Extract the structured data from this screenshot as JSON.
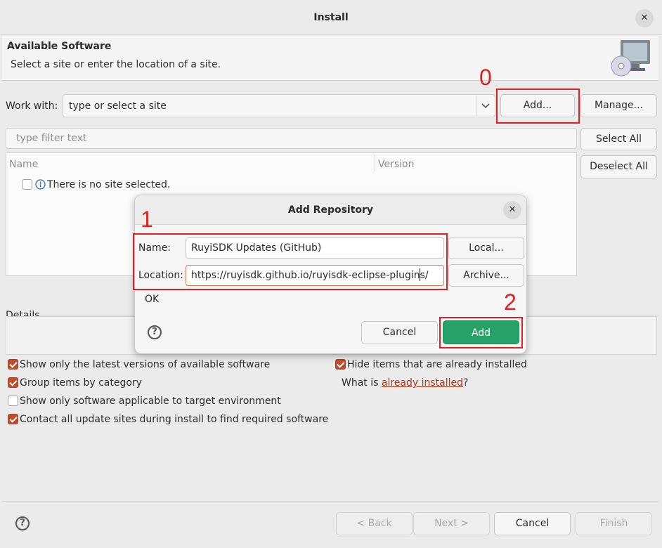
{
  "window": {
    "title": "Install",
    "close_icon": "close-icon"
  },
  "banner": {
    "title": "Available Software",
    "description": "Select a site or enter the location of a site.",
    "icon": "monitor-cd-icon"
  },
  "work_with": {
    "label": "Work with:",
    "value": "type or select a site",
    "add_label": "Add...",
    "manage_label": "Manage..."
  },
  "filter": {
    "placeholder": "type filter text",
    "select_all_label": "Select All",
    "deselect_all_label": "Deselect All"
  },
  "table": {
    "columns": [
      "Name",
      "Version"
    ],
    "rows": [
      {
        "text": "There is no site selected.",
        "checked": false,
        "icon": "info-icon"
      }
    ]
  },
  "details": {
    "label": "Details"
  },
  "options": {
    "left": [
      {
        "label": "Show only the latest versions of available software",
        "checked": true
      },
      {
        "label": "Group items by category",
        "checked": true
      },
      {
        "label": "Show only software applicable to target environment",
        "checked": false
      },
      {
        "label": "Contact all update sites during install to find required software",
        "checked": true
      }
    ],
    "right": [
      {
        "label": "Hide items that are already installed",
        "checked": true
      }
    ],
    "what_is_prefix": "What is ",
    "already_installed_link": "already installed",
    "what_is_suffix": "?"
  },
  "footer": {
    "help_icon": "help-icon",
    "back_label": "< Back",
    "next_label": "Next >",
    "cancel_label": "Cancel",
    "finish_label": "Finish"
  },
  "dialog": {
    "title": "Add Repository",
    "name_label": "Name:",
    "name_value": "RuyiSDK Updates (GitHub)",
    "location_label": "Location:",
    "location_value": "https://ruyisdk.github.io/ruyisdk-eclipse-plugins/",
    "local_label": "Local...",
    "archive_label": "Archive...",
    "status": "OK",
    "cancel_label": "Cancel",
    "add_label": "Add",
    "add_color": "#26a269"
  },
  "annotations": {
    "color": "#e02020",
    "step_0": "0",
    "step_1": "1",
    "step_2": "2"
  }
}
